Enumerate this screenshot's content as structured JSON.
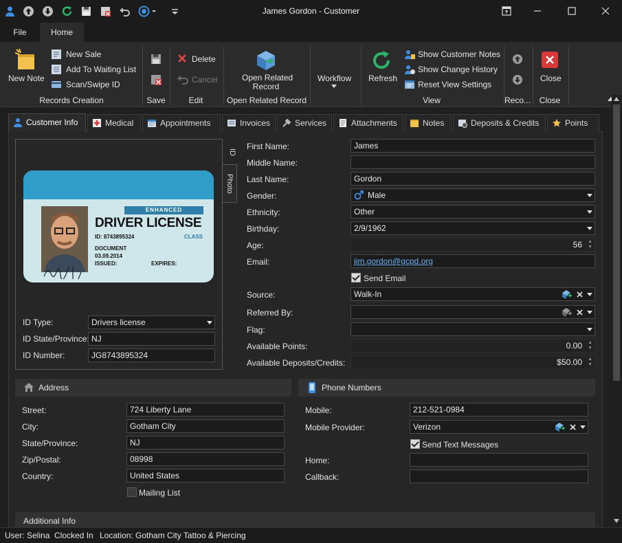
{
  "window": {
    "title": "James Gordon - Customer"
  },
  "menu": {
    "tabs": [
      "File",
      "Home"
    ]
  },
  "ribbon": {
    "new_note": "New Note",
    "new_sale": "New Sale",
    "add_waiting": "Add To Waiting List",
    "scan_id": "Scan/Swipe ID",
    "group_records_creation": "Records Creation",
    "group_save": "Save",
    "delete": "Delete",
    "cancel": "Cancel",
    "group_edit": "Edit",
    "open_related": "Open Related\nRecord",
    "open_related_line1": "Open Related",
    "open_related_line2": "Record",
    "group_open_related": "Open Related Record",
    "workflow": "Workflow",
    "refresh": "Refresh",
    "show_notes": "Show Customer Notes",
    "show_history": "Show Change History",
    "reset_view": "Reset View Settings",
    "group_view": "View",
    "group_reco": "Reco...",
    "close": "Close",
    "group_close": "Close"
  },
  "tabs": [
    "Customer Info",
    "Medical",
    "Appointments",
    "Invoices",
    "Services",
    "Attachments",
    "Notes",
    "Deposits & Credits",
    "Points"
  ],
  "id_panel": {
    "side_tab_id": "ID",
    "side_tab_photo": "Photo",
    "card": {
      "enhanced": "ENHANCED",
      "heading": "DRIVER LICENSE",
      "id_line": "ID: 8743895324",
      "class_label": "CLASS",
      "document_label": "DOCUMENT",
      "document_date": "03.09.2014",
      "issued_label": "ISSUED:",
      "expires_label": "EXPIRES:"
    },
    "id_type_label": "ID Type:",
    "id_type_value": "Drivers license",
    "id_state_label": "ID State/Province:",
    "id_state_value": "NJ",
    "id_number_label": "ID Number:",
    "id_number_value": "JG8743895324"
  },
  "customer": {
    "first_name_label": "First Name:",
    "first_name": "James",
    "middle_name_label": "Middle Name:",
    "middle_name": "",
    "last_name_label": "Last Name:",
    "last_name": "Gordon",
    "gender_label": "Gender:",
    "gender": "Male",
    "ethnicity_label": "Ethnicity:",
    "ethnicity": "Other",
    "birthday_label": "Birthday:",
    "birthday": "2/9/1962",
    "age_label": "Age:",
    "age": "56",
    "email_label": "Email:",
    "email": "jim.gordon@gcpd.org",
    "send_email_label": "Send Email",
    "send_email": true,
    "source_label": "Source:",
    "source": "Walk-In",
    "referred_label": "Referred By:",
    "referred": "",
    "flag_label": "Flag:",
    "flag": "",
    "points_label": "Available Points:",
    "points": "0.00",
    "deposits_label": "Available Deposits/Credits:",
    "deposits": "$50.00"
  },
  "address": {
    "header": "Address",
    "street_label": "Street:",
    "street": "724 Liberty Lane",
    "city_label": "City:",
    "city": "Gotham City",
    "state_label": "State/Province:",
    "state": "NJ",
    "zip_label": "Zip/Postal:",
    "zip": "08998",
    "country_label": "Country:",
    "country": "United States",
    "mailing_label": "Mailing List",
    "mailing": false
  },
  "phones": {
    "header": "Phone Numbers",
    "mobile_label": "Mobile:",
    "mobile": "212-521-0984",
    "provider_label": "Mobile Provider:",
    "provider": "Verizon",
    "send_text_label": "Send Text Messages",
    "send_text": true,
    "home_label": "Home:",
    "home": "",
    "callback_label": "Callback:",
    "callback": ""
  },
  "additional": {
    "header": "Additional Info"
  },
  "status": {
    "user": "User: Selina",
    "clocked": "Clocked In",
    "location": "Location: Gotham City Tattoo & Piercing"
  }
}
